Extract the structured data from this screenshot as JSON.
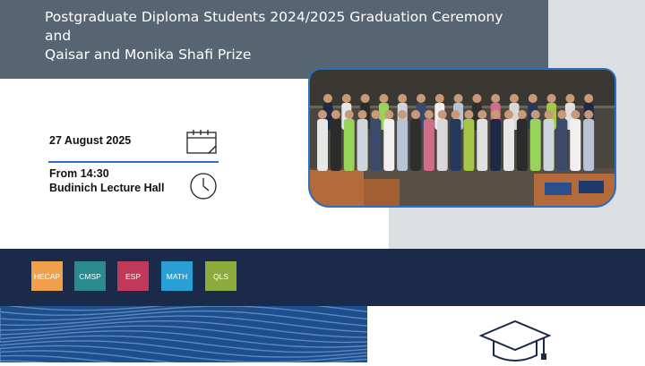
{
  "title": {
    "line1": "Postgraduate Diploma Students 2024/2025 Graduation Ceremony",
    "line2": "and",
    "line3": "Qaisar and Monika Shafi Prize"
  },
  "event": {
    "date": "27 August 2025",
    "time": "From 14:30",
    "venue": "Budinich Lecture Hall"
  },
  "departments": [
    {
      "label": "HECAP",
      "color": "#f0a04b"
    },
    {
      "label": "CMSP",
      "color": "#2a8a8c"
    },
    {
      "label": "ESP",
      "color": "#c0395a"
    },
    {
      "label": "MATH",
      "color": "#2a9fd6"
    },
    {
      "label": "QLS",
      "color": "#8dab3c"
    }
  ],
  "colors": {
    "accent": "#2b6fc7",
    "title_bg": "#576572",
    "dept_band": "#1c2a4a",
    "waves": "#1d4f8f"
  },
  "icons": [
    "calendar-icon",
    "clock-icon",
    "graduation-cap-icon"
  ]
}
